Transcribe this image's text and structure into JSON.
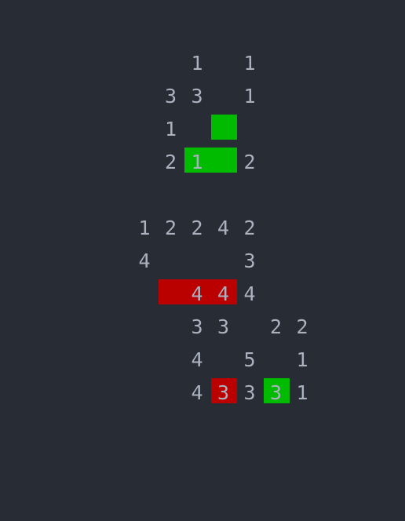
{
  "board": {
    "colors": {
      "background": "#282c34",
      "digit": "#abb2bf",
      "green": "#00bb00",
      "red": "#bb0000"
    },
    "cell_size": 34,
    "origin_col": 0,
    "rows": [
      {
        "row": 2,
        "cells": [
          {
            "col": 7,
            "text": "1"
          },
          {
            "col": 9,
            "text": "1"
          }
        ]
      },
      {
        "row": 3,
        "cells": [
          {
            "col": 6,
            "text": "3"
          },
          {
            "col": 7,
            "text": "3"
          },
          {
            "col": 9,
            "text": "1"
          }
        ]
      },
      {
        "row": 4,
        "cells": [
          {
            "col": 6,
            "text": "1"
          }
        ]
      },
      {
        "row": 5,
        "cells": [
          {
            "col": 6,
            "text": "2"
          },
          {
            "col": 7,
            "text": "1"
          },
          {
            "col": 9,
            "text": "2"
          }
        ]
      },
      {
        "row": 7,
        "cells": [
          {
            "col": 5,
            "text": "1"
          },
          {
            "col": 6,
            "text": "2"
          },
          {
            "col": 7,
            "text": "2"
          },
          {
            "col": 8,
            "text": "4"
          },
          {
            "col": 9,
            "text": "2"
          }
        ]
      },
      {
        "row": 8,
        "cells": [
          {
            "col": 5,
            "text": "4"
          },
          {
            "col": 9,
            "text": "3"
          }
        ]
      },
      {
        "row": 9,
        "cells": [
          {
            "col": 7,
            "text": "4"
          },
          {
            "col": 8,
            "text": "4"
          },
          {
            "col": 9,
            "text": "4"
          }
        ]
      },
      {
        "row": 10,
        "cells": [
          {
            "col": 7,
            "text": "3"
          },
          {
            "col": 8,
            "text": "3"
          },
          {
            "col": 10,
            "text": "2"
          },
          {
            "col": 11,
            "text": "2"
          }
        ]
      },
      {
        "row": 11,
        "cells": [
          {
            "col": 7,
            "text": "4"
          },
          {
            "col": 9,
            "text": "5"
          },
          {
            "col": 11,
            "text": "1"
          }
        ]
      },
      {
        "row": 12,
        "cells": [
          {
            "col": 7,
            "text": "4"
          },
          {
            "col": 8,
            "text": "3"
          },
          {
            "col": 9,
            "text": "3"
          },
          {
            "col": 10,
            "text": "3"
          },
          {
            "col": 11,
            "text": "1"
          }
        ]
      }
    ],
    "blocks": [
      {
        "color": "green",
        "row": 3,
        "col": 8,
        "span": 1
      },
      {
        "color": "green",
        "row": 4,
        "col": 7,
        "span": 2
      },
      {
        "color": "red",
        "row": 8,
        "col": 6,
        "span": 3
      },
      {
        "color": "red",
        "row": 11,
        "col": 8,
        "span": 1
      },
      {
        "color": "green",
        "row": 11,
        "col": 10,
        "span": 1
      }
    ]
  }
}
